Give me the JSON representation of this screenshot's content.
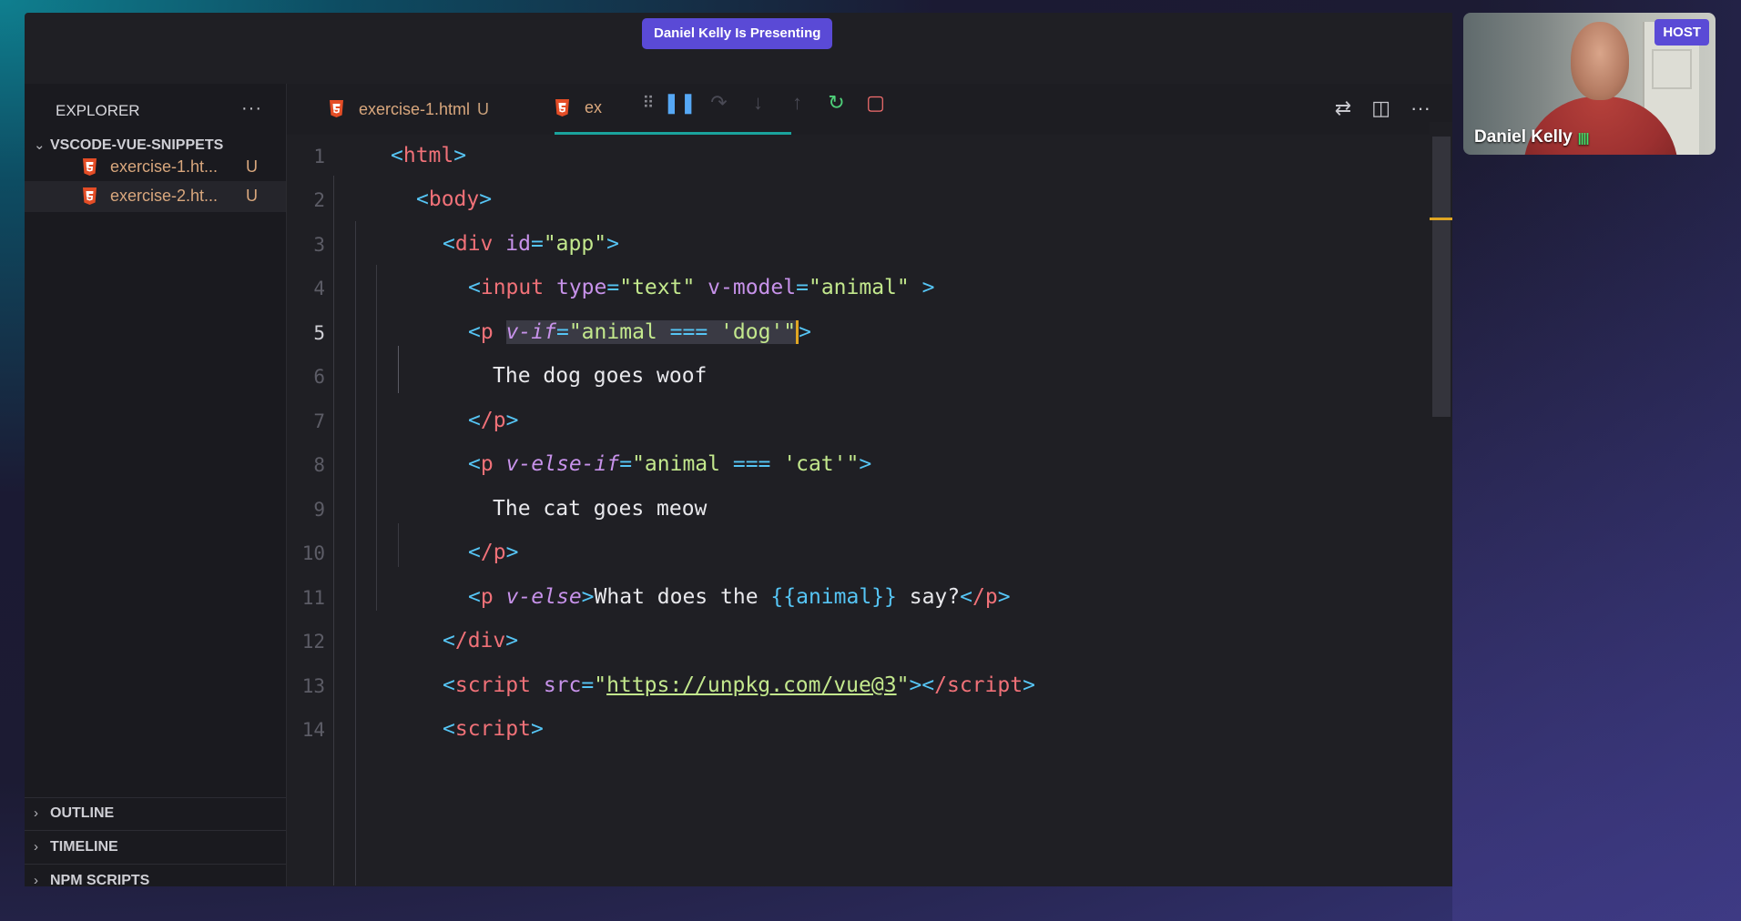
{
  "meeting": {
    "presenting_banner": "Daniel Kelly Is Presenting",
    "participant_name": "Daniel Kelly",
    "host_badge": "HOST",
    "audio_bars": "||||"
  },
  "sidebar": {
    "title": "EXPLORER",
    "more": "···",
    "folder": "VSCODE-VUE-SNIPPETS",
    "files": [
      {
        "name": "exercise-1.ht...",
        "status": "U"
      },
      {
        "name": "exercise-2.ht...",
        "status": "U"
      }
    ],
    "sections": [
      "OUTLINE",
      "TIMELINE",
      "NPM SCRIPTS"
    ]
  },
  "tabs": [
    {
      "label": "exercise-1.html",
      "status": "U"
    },
    {
      "label": "ex"
    }
  ],
  "code_lines": [
    {
      "n": "1"
    },
    {
      "n": "2"
    },
    {
      "n": "3"
    },
    {
      "n": "4"
    },
    {
      "n": "5"
    },
    {
      "n": "6"
    },
    {
      "n": "7"
    },
    {
      "n": "8"
    },
    {
      "n": "9"
    },
    {
      "n": "10"
    },
    {
      "n": "11"
    },
    {
      "n": "12"
    },
    {
      "n": "13"
    },
    {
      "n": "14"
    }
  ],
  "code": {
    "l1_tag": "html",
    "l2_tag": "body",
    "l3_tag": "div",
    "l3_attr": "id",
    "l3_val": "\"app\"",
    "l4_tag": "input",
    "l4_attr1": "type",
    "l4_val1": "\"text\"",
    "l4_attr2": "v-model",
    "l4_val2": "\"animal\"",
    "l5_tag": "p",
    "l5_attr": "v-if",
    "l5_val_open": "\"animal",
    "l5_op": "===",
    "l5_val_close": "'dog'\"",
    "l6_text": "The dog goes woof",
    "l7_tag": "/p",
    "l8_tag": "p",
    "l8_attr": "v-else-if",
    "l8_val_open": "\"animal",
    "l8_op": "===",
    "l8_val_close": "'cat'\"",
    "l9_text": "The cat goes meow",
    "l10_tag": "/p",
    "l11_tag": "p",
    "l11_attr": "v-else",
    "l11_text1": "What does the ",
    "l11_mustache": "{{animal}}",
    "l11_text2": " say?",
    "l11_close": "/p",
    "l12_tag": "/div",
    "l13_tag": "script",
    "l13_attr": "src",
    "l13_url": "https://unpkg.com/vue@3",
    "l13_close": "/script",
    "l14_tag": "script"
  },
  "colors": {
    "accent_purple": "#5a4ad6",
    "html_icon": "#e44d26",
    "modified_file": "#d9a77d"
  }
}
